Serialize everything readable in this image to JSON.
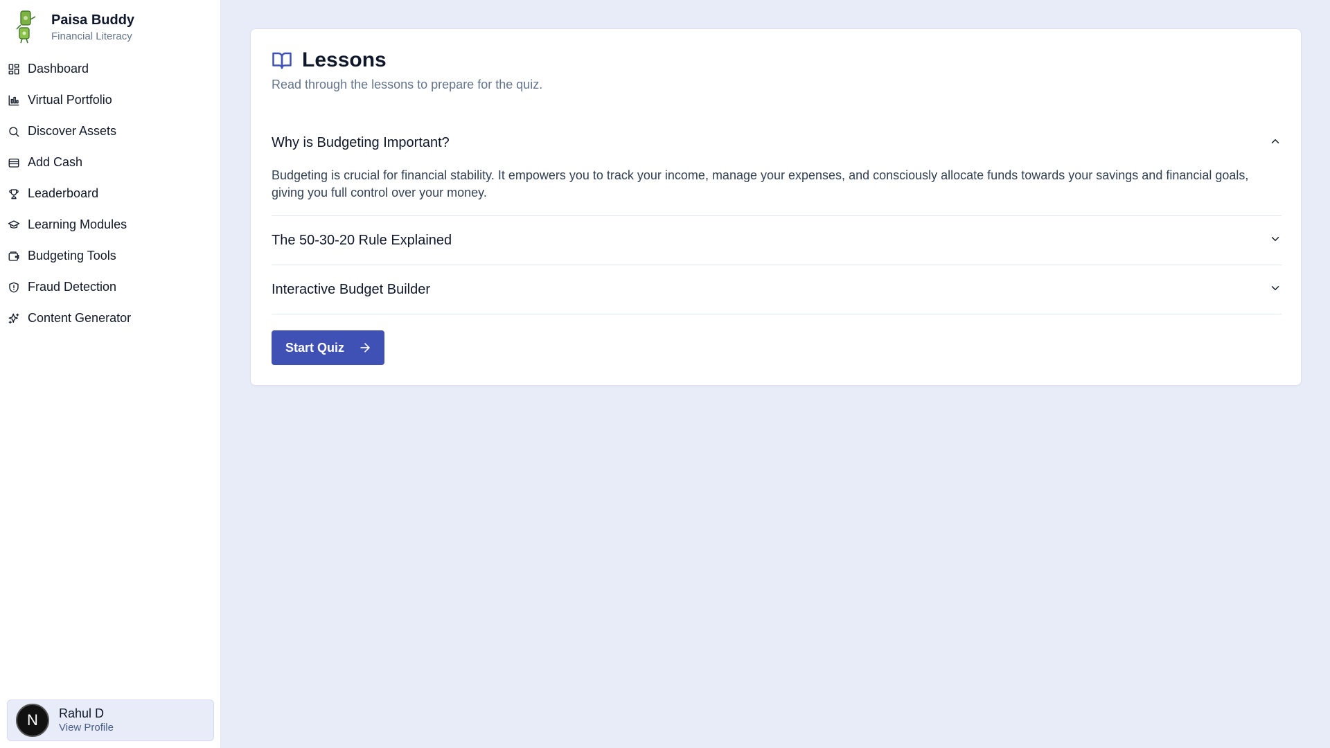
{
  "brand": {
    "title": "Paisa Buddy",
    "subtitle": "Financial Literacy",
    "logo_icon": "money-mascot-icon"
  },
  "sidebar": {
    "items": [
      {
        "label": "Dashboard",
        "icon": "dashboard-icon"
      },
      {
        "label": "Virtual Portfolio",
        "icon": "chart-icon"
      },
      {
        "label": "Discover Assets",
        "icon": "search-icon"
      },
      {
        "label": "Add Cash",
        "icon": "wallet-icon"
      },
      {
        "label": "Leaderboard",
        "icon": "trophy-icon"
      },
      {
        "label": "Learning Modules",
        "icon": "graduation-cap-icon"
      },
      {
        "label": "Budgeting Tools",
        "icon": "purse-icon"
      },
      {
        "label": "Fraud Detection",
        "icon": "shield-icon"
      },
      {
        "label": "Content Generator",
        "icon": "sparkles-icon"
      }
    ]
  },
  "profile": {
    "initial": "N",
    "name": "Rahul D",
    "link": "View Profile"
  },
  "lessons": {
    "title": "Lessons",
    "subtitle": "Read through the lessons to prepare for the quiz.",
    "items": [
      {
        "title": "Why is Budgeting Important?",
        "expanded": true,
        "body": "Budgeting is crucial for financial stability. It empowers you to track your income, manage your expenses, and consciously allocate funds towards your savings and financial goals, giving you full control over your money."
      },
      {
        "title": "The 50-30-20 Rule Explained",
        "expanded": false
      },
      {
        "title": "Interactive Budget Builder",
        "expanded": false
      }
    ],
    "button_label": "Start Quiz"
  },
  "colors": {
    "accent": "#3f51b5",
    "background": "#e8ebf8"
  }
}
